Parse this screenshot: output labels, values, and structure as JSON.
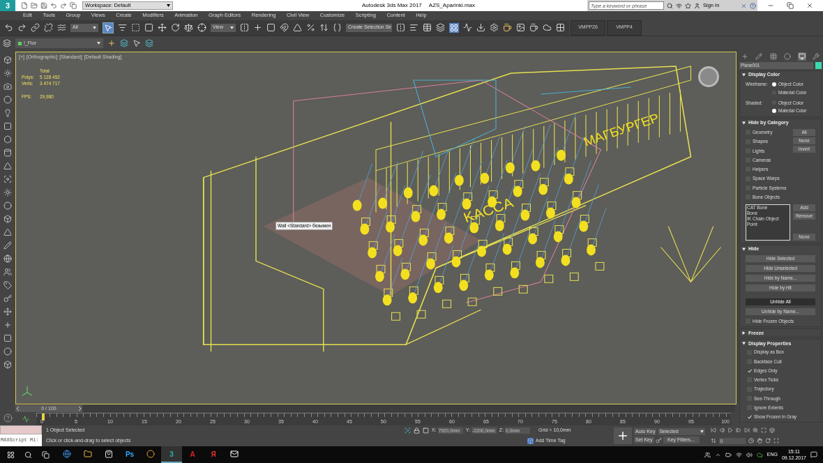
{
  "title_bar": {
    "logo": "3",
    "workspace": "Workspace: Default",
    "app_title": "Autodesk 3ds Max 2017",
    "file_name": "AZS_Aparinki.max",
    "search_placeholder": "Type a keyword or phrase",
    "sign_in": "Sign In"
  },
  "menu": [
    "Edit",
    "Tools",
    "Group",
    "Views",
    "Create",
    "Modifiers",
    "Animation",
    "Graph Editors",
    "Rendering",
    "Civil View",
    "Customize",
    "Scripting",
    "Content",
    "Help"
  ],
  "main_toolbar": {
    "selection_filter": "All",
    "reference_coord": "View",
    "selection_set": "Create Selection Se",
    "tabs": [
      "VMPP26",
      "VMPP4"
    ]
  },
  "layer_toolbar": {
    "layer": "!_Flor"
  },
  "viewport": {
    "labels": [
      "[+]",
      "[Orthographic]",
      "[Standard]",
      "[Default Shading]"
    ],
    "stats_header": "Total",
    "stats": [
      {
        "label": "Polys:",
        "value": "5 128 452"
      },
      {
        "label": "Verts:",
        "value": "3 474 717"
      }
    ],
    "fps_label": "FPS:",
    "fps": "29,980",
    "tooltip": "Wall <Standard> безымен",
    "scene_signs": [
      "KACCA",
      "МАГБУРГЕР"
    ]
  },
  "command_panel": {
    "tabs": [
      {
        "kind": "create",
        "selected": false
      },
      {
        "kind": "modify",
        "selected": false
      },
      {
        "kind": "hierarchy",
        "selected": false
      },
      {
        "kind": "motion",
        "selected": false
      },
      {
        "kind": "display",
        "selected": true
      },
      {
        "kind": "utilities",
        "selected": false
      }
    ],
    "object_name": "Plane001",
    "rollouts": [
      {
        "kind": "display_color",
        "title": "Display Color",
        "expanded": true,
        "groups": [
          {
            "label": "Wireframe:",
            "options": [
              {
                "label": "Object Color",
                "selected": true
              },
              {
                "label": "Material Color",
                "selected": false
              }
            ]
          },
          {
            "label": "Shaded:",
            "options": [
              {
                "label": "Object Color",
                "selected": false
              },
              {
                "label": "Material Color",
                "selected": true
              }
            ]
          }
        ]
      },
      {
        "kind": "hide_by_category",
        "title": "Hide by Category",
        "expanded": true,
        "checkboxes": [
          {
            "label": "Geometry",
            "checked": false
          },
          {
            "label": "Shapes",
            "checked": false
          },
          {
            "label": "Lights",
            "checked": false
          },
          {
            "label": "Cameras",
            "checked": false
          },
          {
            "label": "Helpers",
            "checked": false
          },
          {
            "label": "Space Warps",
            "checked": false
          },
          {
            "label": "Particle Systems",
            "checked": false
          },
          {
            "label": "Bone Objects",
            "checked": false
          }
        ],
        "buttons": [
          "All",
          "None",
          "Invert"
        ],
        "list": [
          "CAT Bone",
          "Bone",
          "IK Chain Object",
          "Point"
        ],
        "list_buttons": [
          "Add",
          "Remove"
        ],
        "list_none": "None"
      },
      {
        "kind": "buttons",
        "title": "Hide",
        "expanded": true,
        "buttons": [
          {
            "label": "Hide Selected",
            "pressed": false
          },
          {
            "label": "Hide Unselected",
            "pressed": false
          },
          {
            "label": "Hide by Name...",
            "pressed": false
          },
          {
            "label": "Hide by Hit",
            "pressed": false
          },
          {
            "label": "Unhide All",
            "pressed": true
          },
          {
            "label": "Unhide by Name...",
            "pressed": false
          }
        ],
        "checkboxes": [
          {
            "label": "Hide Frozen Objects",
            "checked": false
          }
        ]
      },
      {
        "title": "Freeze",
        "expanded": false
      },
      {
        "kind": "checkbox_list",
        "title": "Display Properties",
        "expanded": true,
        "checkboxes": [
          {
            "label": "Display as Box",
            "checked": false
          },
          {
            "label": "Backface Cull",
            "checked": false
          },
          {
            "label": "Edges Only",
            "checked": true
          },
          {
            "label": "Vertex Ticks",
            "checked": false
          },
          {
            "label": "Trajectory",
            "checked": false
          },
          {
            "label": "See-Through",
            "checked": false
          },
          {
            "label": "Ignore Extents",
            "checked": false
          },
          {
            "label": "Show Frozen in Gray",
            "checked": true
          }
        ]
      }
    ]
  },
  "timeline": {
    "frame_range": "0 / 100",
    "level": 0,
    "ticks": [
      "0",
      "5",
      "10",
      "15",
      "20",
      "25",
      "30",
      "35",
      "40",
      "45",
      "50",
      "55",
      "60",
      "65",
      "70",
      "75",
      "80",
      "85",
      "90",
      "95",
      "100"
    ]
  },
  "status": {
    "listener": "MAXScript Mi:",
    "selection": "1 Object Selected",
    "prompt": "Click or click-and-drag to select objects",
    "coords": [
      {
        "label": "X:",
        "value": "7920,0mm"
      },
      {
        "label": "Y:",
        "value": "-2200,0mm"
      },
      {
        "label": "Z:",
        "value": "0,0mm"
      }
    ],
    "grid": "Grid = 10,0mm",
    "time_tag": "Add Time Tag",
    "auto_key": "Auto Key",
    "key_mode": "Selected",
    "set_key": "Set Key",
    "key_filters": "Key Filters...",
    "frame": "0"
  },
  "taskbar": {
    "apps": [
      {
        "kind": "edge",
        "selected": false
      },
      {
        "kind": "folder",
        "selected": false
      },
      {
        "kind": "store",
        "selected": false
      },
      {
        "kind": "letter",
        "label": "Ps",
        "color": "#31a8ff",
        "selected": false
      },
      {
        "kind": "chrome",
        "selected": false
      },
      {
        "kind": "letter",
        "label": "3",
        "color": "#23b3b3",
        "selected": true
      },
      {
        "kind": "letter",
        "label": "A",
        "color": "#e02020",
        "selected": false
      },
      {
        "kind": "letter",
        "label": "Я",
        "color": "#e83030",
        "selected": false
      },
      {
        "kind": "mail",
        "selected": false
      }
    ],
    "language": "ENG",
    "time": "15:11",
    "date": "09.12.2017"
  }
}
